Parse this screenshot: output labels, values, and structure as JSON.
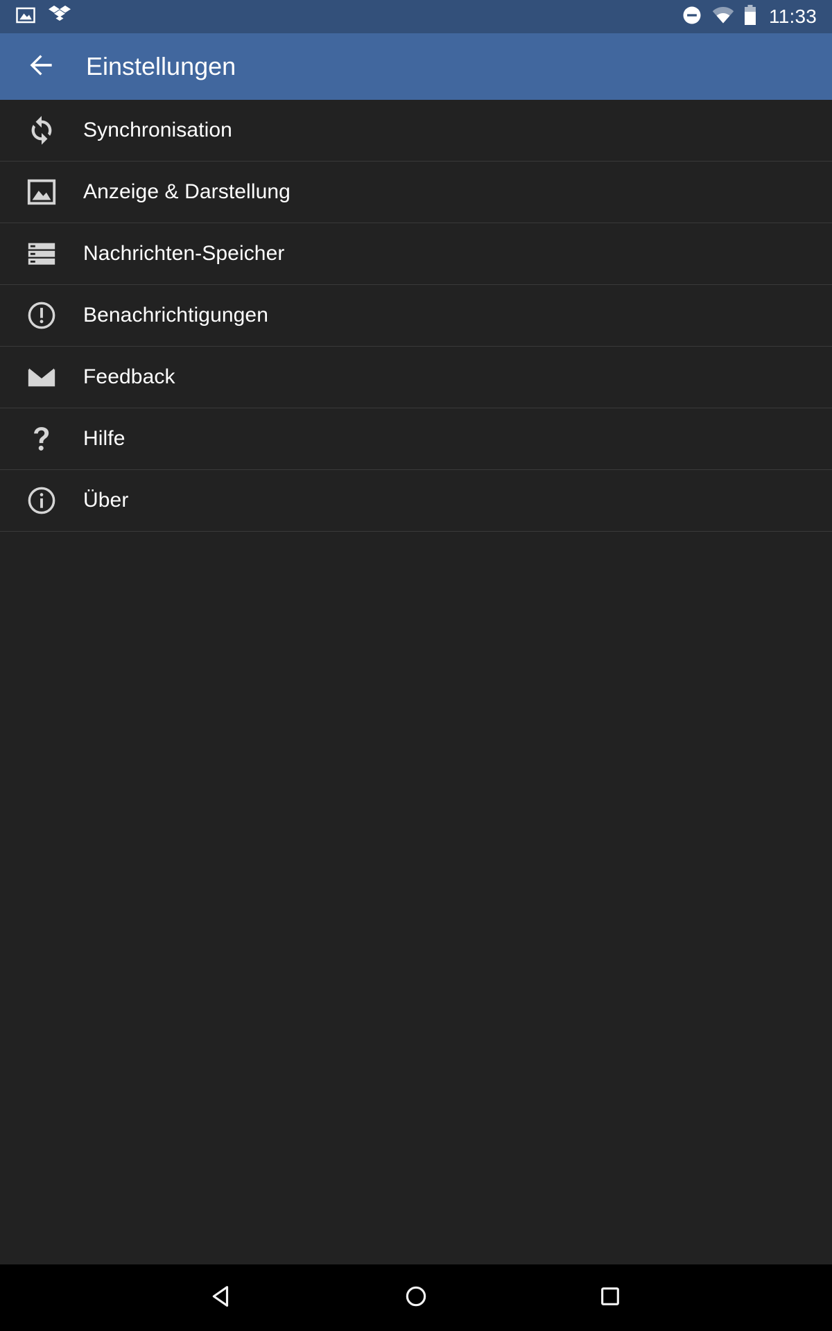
{
  "status_bar": {
    "background_color": "#33507a",
    "left_icons": [
      {
        "name": "screenshot-image-icon",
        "label": "screenshot-image-icon"
      },
      {
        "name": "dropbox-icon",
        "label": "dropbox-icon"
      }
    ],
    "right_icons": [
      {
        "name": "do-not-disturb-icon",
        "label": "do-not-disturb-icon"
      },
      {
        "name": "wifi-icon",
        "label": "wifi-icon"
      },
      {
        "name": "battery-icon",
        "label": "battery-icon"
      }
    ],
    "time": "11:33"
  },
  "app_bar": {
    "background_color": "#41679e",
    "back_icon": "arrow-back-icon",
    "title": "Einstellungen"
  },
  "list": {
    "background_color": "#222222",
    "divider_color": "#3a3a3a",
    "items": [
      {
        "label": "Synchronisation",
        "icon": "sync-icon"
      },
      {
        "label": "Anzeige & Darstellung",
        "icon": "image-icon"
      },
      {
        "label": "Nachrichten-Speicher",
        "icon": "storage-icon"
      },
      {
        "label": "Benachrichtigungen",
        "icon": "alert-circle-icon"
      },
      {
        "label": "Feedback",
        "icon": "mail-icon"
      },
      {
        "label": "Hilfe",
        "icon": "question-mark-icon"
      },
      {
        "label": "Über",
        "icon": "info-circle-icon"
      }
    ]
  },
  "nav_bar": {
    "background_color": "#000000",
    "buttons": [
      {
        "name": "nav-back-button",
        "icon": "triangle-back-icon"
      },
      {
        "name": "nav-home-button",
        "icon": "circle-home-icon"
      },
      {
        "name": "nav-recents-button",
        "icon": "square-recents-icon"
      }
    ]
  }
}
